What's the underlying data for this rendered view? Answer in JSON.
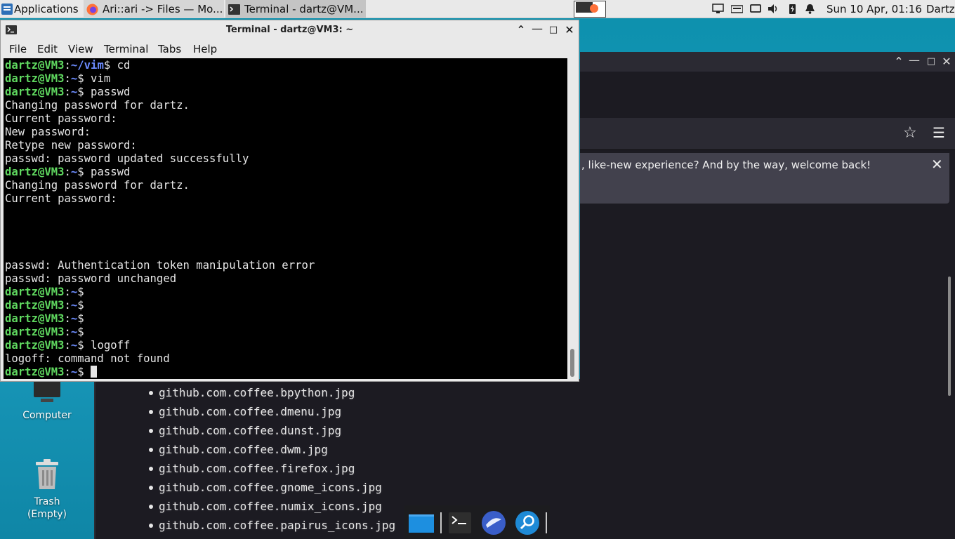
{
  "top_panel": {
    "applications_label": "Applications",
    "tasks": [
      {
        "label": "Ari::ari -> Files — Mo..."
      },
      {
        "label": "Terminal - dartz@VM..."
      }
    ],
    "clock": "Sun 10 Apr, 01:16",
    "user": "Dartz",
    "tray_icons": [
      "network-icon",
      "keyboard-icon",
      "display-icon",
      "volume-icon",
      "battery-icon",
      "notification-bell-icon"
    ]
  },
  "terminal": {
    "title": "Terminal - dartz@VM3: ~",
    "menu": [
      "File",
      "Edit",
      "View",
      "Terminal",
      "Tabs",
      "Help"
    ],
    "prompt_user": "dartz@VM3",
    "lines": [
      {
        "type": "prompt",
        "path": "~/vim",
        "cmd": " cd"
      },
      {
        "type": "prompt",
        "path": "~",
        "cmd": " vim"
      },
      {
        "type": "prompt",
        "path": "~",
        "cmd": " passwd"
      },
      {
        "type": "out",
        "text": "Changing password for dartz."
      },
      {
        "type": "out",
        "text": "Current password:"
      },
      {
        "type": "out",
        "text": "New password:"
      },
      {
        "type": "out",
        "text": "Retype new password:"
      },
      {
        "type": "out",
        "text": "passwd: password updated successfully"
      },
      {
        "type": "prompt",
        "path": "~",
        "cmd": " passwd"
      },
      {
        "type": "out",
        "text": "Changing password for dartz."
      },
      {
        "type": "out",
        "text": "Current password:"
      },
      {
        "type": "out",
        "text": ""
      },
      {
        "type": "out",
        "text": ""
      },
      {
        "type": "out",
        "text": ""
      },
      {
        "type": "out",
        "text": ""
      },
      {
        "type": "out",
        "text": "passwd: Authentication token manipulation error"
      },
      {
        "type": "out",
        "text": "passwd: password unchanged"
      },
      {
        "type": "prompt",
        "path": "~",
        "cmd": ""
      },
      {
        "type": "prompt",
        "path": "~",
        "cmd": ""
      },
      {
        "type": "prompt",
        "path": "~",
        "cmd": ""
      },
      {
        "type": "prompt",
        "path": "~",
        "cmd": ""
      },
      {
        "type": "prompt",
        "path": "~",
        "cmd": " logoff"
      },
      {
        "type": "out",
        "text": "logoff: command not found"
      },
      {
        "type": "prompt",
        "path": "~",
        "cmd": " ",
        "cursor": true
      }
    ]
  },
  "browser": {
    "notice_text": ", like-new experience? And by the way, welcome back!"
  },
  "file_list": [
    "github.com.coffee.bpython.jpg",
    "github.com.coffee.dmenu.jpg",
    "github.com.coffee.dunst.jpg",
    "github.com.coffee.dwm.jpg",
    "github.com.coffee.firefox.jpg",
    "github.com.coffee.gnome_icons.jpg",
    "github.com.coffee.numix_icons.jpg",
    "github.com.coffee.papirus_icons.jpg"
  ],
  "desktop": {
    "computer_label": "Computer",
    "trash_label": "Trash",
    "trash_sub": "(Empty)"
  },
  "colors": {
    "prompt_user": "#5fd75f",
    "prompt_path": "#6c8cff",
    "desktop": "#1a9bbd"
  }
}
